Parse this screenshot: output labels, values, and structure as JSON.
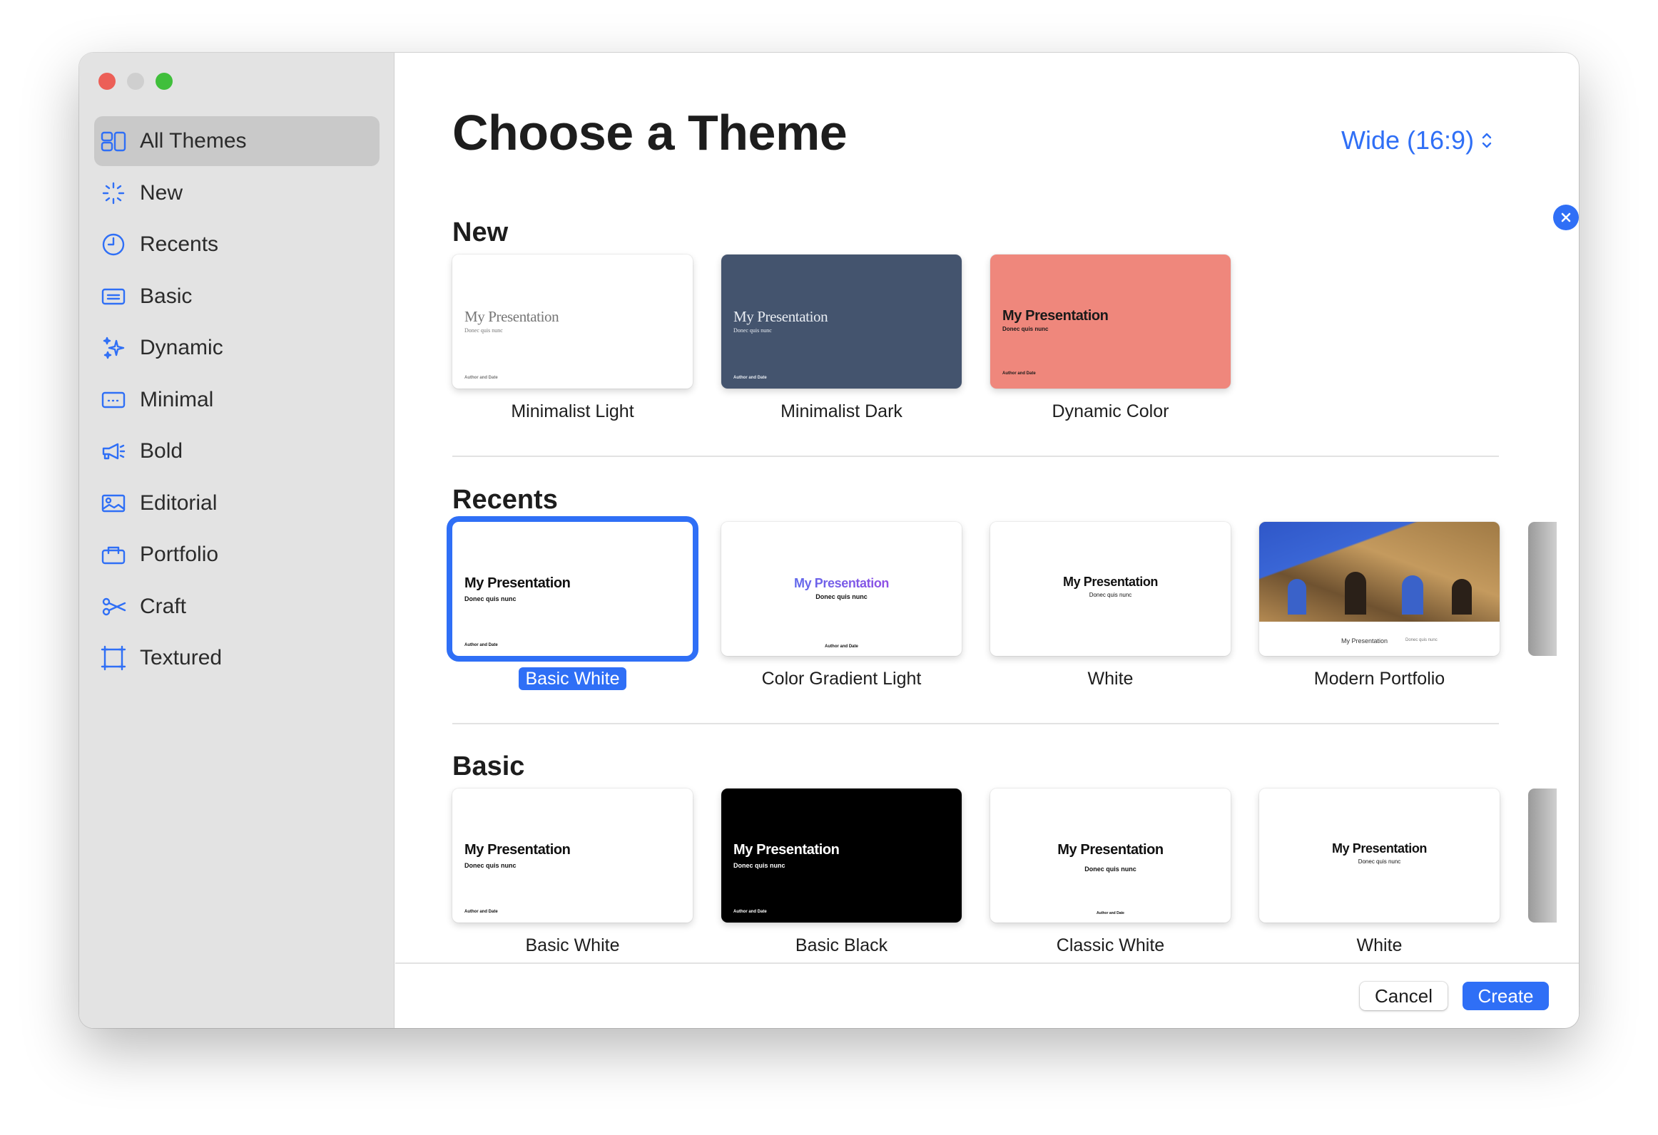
{
  "window": {
    "traffic_lights": [
      {
        "name": "close",
        "color": "#ec5f57"
      },
      {
        "name": "minimize",
        "color": "#cfcfcf"
      },
      {
        "name": "zoom",
        "color": "#40bf3b"
      }
    ]
  },
  "sidebar": {
    "accent": "#2f6ff6",
    "selected_index": 0,
    "items": [
      {
        "label": "All Themes",
        "icon": "grid-icon"
      },
      {
        "label": "New",
        "icon": "sparkle-burst-icon"
      },
      {
        "label": "Recents",
        "icon": "clock-icon"
      },
      {
        "label": "Basic",
        "icon": "text-slide-icon"
      },
      {
        "label": "Dynamic",
        "icon": "sparkles-icon"
      },
      {
        "label": "Minimal",
        "icon": "dots-slide-icon"
      },
      {
        "label": "Bold",
        "icon": "megaphone-icon"
      },
      {
        "label": "Editorial",
        "icon": "photo-icon"
      },
      {
        "label": "Portfolio",
        "icon": "briefcase-icon"
      },
      {
        "label": "Craft",
        "icon": "scissors-icon"
      },
      {
        "label": "Textured",
        "icon": "frame-icon"
      }
    ]
  },
  "main": {
    "title": "Choose a Theme",
    "slide_size": "Wide (16:9)",
    "sections": [
      {
        "heading": "New",
        "themes": [
          {
            "label": "Minimalist Light",
            "bg": "#ffffff",
            "fg": "#777777",
            "style": "serif",
            "preview": {
              "title": "My Presentation",
              "subtitle": "Donec quis nunc",
              "footer": "Author and Date"
            }
          },
          {
            "label": "Minimalist Dark",
            "bg": "#44546e",
            "fg": "#e8ecf2",
            "style": "serif",
            "preview": {
              "title": "My Presentation",
              "subtitle": "Donec quis nunc",
              "footer": "Author and Date"
            }
          },
          {
            "label": "Dynamic Color",
            "bg": "#ef877c",
            "fg": "#1a1a1a",
            "style": "left",
            "preview": {
              "title": "My Presentation",
              "subtitle": "Donec quis nunc",
              "footer": "Author and Date"
            }
          }
        ]
      },
      {
        "heading": "Recents",
        "themes": [
          {
            "label": "Basic White",
            "bg": "#ffffff",
            "fg": "#111111",
            "style": "left",
            "selected": true,
            "preview": {
              "title": "My Presentation",
              "subtitle": "Donec quis nunc",
              "footer": "Author and Date"
            }
          },
          {
            "label": "Color Gradient Light",
            "bg": "#ffffff",
            "fg": "#111111",
            "style": "gradient",
            "preview": {
              "title": "My Presentation",
              "subtitle": "Donec quis nunc",
              "footer": "Author and Date"
            }
          },
          {
            "label": "White",
            "bg": "#ffffff",
            "fg": "#111111",
            "style": "center",
            "preview": {
              "title": "My Presentation",
              "subtitle": "Donec quis nunc",
              "footer": ""
            }
          },
          {
            "label": "Modern Portfolio",
            "bg": "#ffffff",
            "fg": "#333333",
            "style": "photo",
            "preview": {
              "title": "My Presentation",
              "subtitle": "Donec quis nunc",
              "footer": ""
            }
          }
        ]
      },
      {
        "heading": "Basic",
        "themes": [
          {
            "label": "Basic White",
            "bg": "#ffffff",
            "fg": "#111111",
            "style": "left",
            "preview": {
              "title": "My Presentation",
              "subtitle": "Donec quis nunc",
              "footer": "Author and Date"
            }
          },
          {
            "label": "Basic Black",
            "bg": "#000000",
            "fg": "#ffffff",
            "style": "left",
            "preview": {
              "title": "My Presentation",
              "subtitle": "Donec quis nunc",
              "footer": "Author and Date"
            }
          },
          {
            "label": "Classic White",
            "bg": "#ffffff",
            "fg": "#111111",
            "style": "classic",
            "preview": {
              "title": "My Presentation",
              "subtitle": "Donec quis nunc",
              "footer": "Author and Date"
            }
          },
          {
            "label": "White",
            "bg": "#ffffff",
            "fg": "#111111",
            "style": "center",
            "preview": {
              "title": "My Presentation",
              "subtitle": "Donec quis nunc",
              "footer": ""
            }
          }
        ]
      }
    ]
  },
  "footer": {
    "cancel_label": "Cancel",
    "create_label": "Create"
  }
}
